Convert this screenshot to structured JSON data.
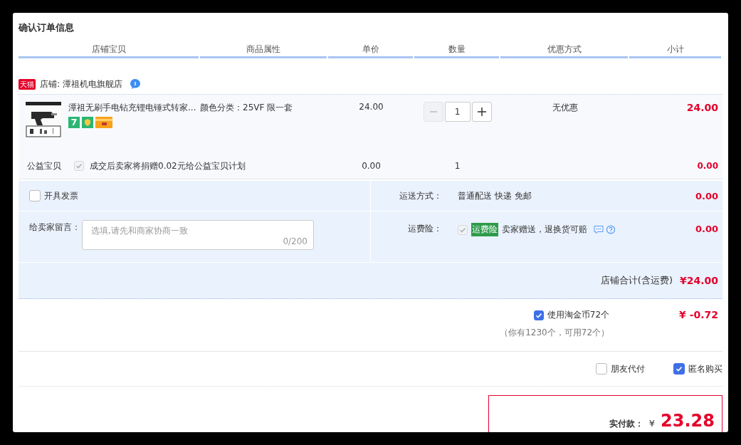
{
  "title": "确认订单信息",
  "columns": [
    "店铺宝贝",
    "商品属性",
    "单价",
    "数量",
    "优惠方式",
    "小计"
  ],
  "shop": {
    "badge": "天猫",
    "label": "店铺: 潭祖机电旗舰店"
  },
  "item": {
    "name": "潭祖无刷手电钻充锂电锤式转家...",
    "attribute": "颜色分类：25VF 限一套",
    "price": "24.00",
    "quantity": "1",
    "discount": "无优惠",
    "subtotal": "24.00",
    "badges": [
      {
        "kind": "text",
        "label": "7"
      },
      {
        "kind": "shield"
      },
      {
        "kind": "card"
      }
    ]
  },
  "charity": {
    "label": "公益宝贝",
    "checked": true,
    "disabled": true,
    "text": "成交后卖家将捐赠0.02元给公益宝贝计划",
    "price": "0.00",
    "quantity": "1",
    "subtotal": "0.00"
  },
  "invoice": {
    "label": "开具发票",
    "checked": false
  },
  "shipping": {
    "label": "运送方式：",
    "value": "普通配送 快递 免邮",
    "amount": "0.00"
  },
  "message": {
    "label": "给卖家留言：",
    "placeholder": "选填,请先和商家协商一致",
    "counter": "0/200"
  },
  "insurance": {
    "label": "运费险：",
    "checked": true,
    "disabled": true,
    "tag": "运费险",
    "text": "卖家赠送，退换货可赔",
    "amount": "0.00"
  },
  "shop_total": {
    "label": "店铺合计(含运费)",
    "amount": "¥24.00"
  },
  "coins": {
    "label": "使用淘金币72个",
    "checked": true,
    "note": "（你有1230个，可用72个）",
    "amount": "¥ -0.72"
  },
  "options": [
    {
      "label": "朋友代付",
      "checked": false
    },
    {
      "label": "匿名购买",
      "checked": true
    }
  ],
  "payment": {
    "label": "实付款：",
    "currency": "¥",
    "amount": "23.28"
  }
}
